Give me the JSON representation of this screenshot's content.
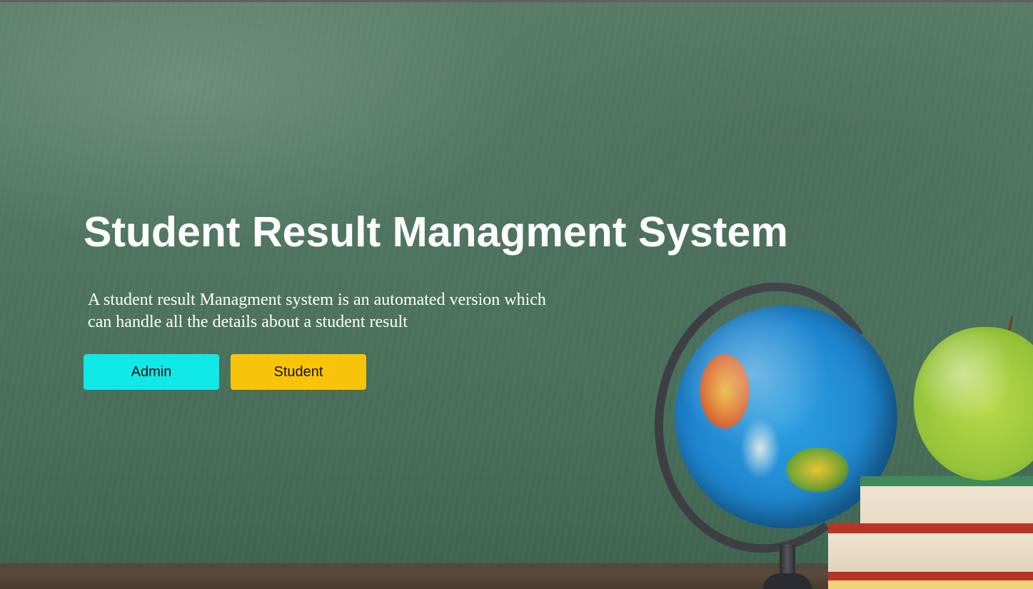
{
  "hero": {
    "title": "Student Result Managment System",
    "description_line1": "A student result Managment system is an automated version which",
    "description_line2": "can handle all the details about a student result"
  },
  "actions": {
    "admin_label": "Admin",
    "student_label": "Student"
  },
  "colors": {
    "admin_button": "#11e8e8",
    "student_button": "#f8c40a",
    "chalkboard": "#4f7561",
    "title_text": "#ffffff"
  }
}
